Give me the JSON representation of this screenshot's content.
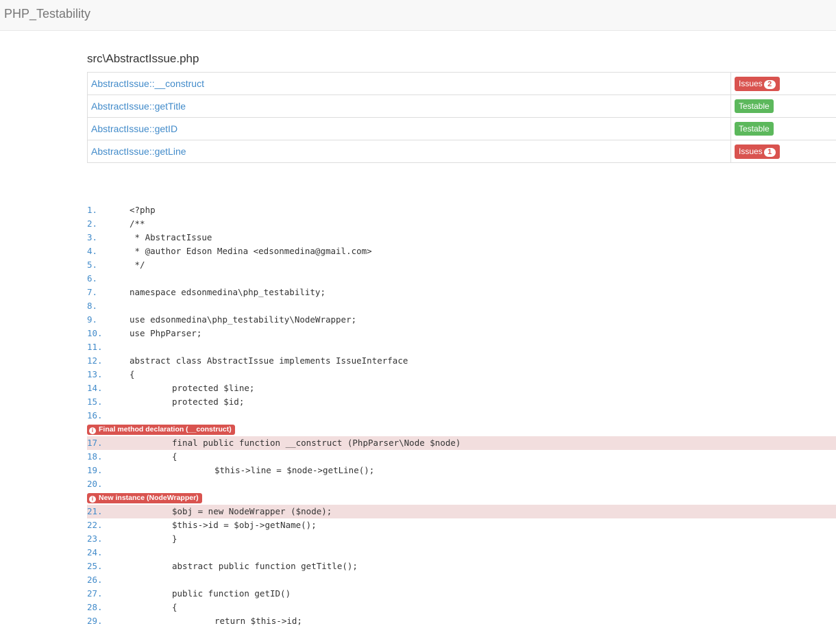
{
  "app": {
    "brand": "PHP_Testability"
  },
  "file": {
    "path": "src\\AbstractIssue.php"
  },
  "methods": [
    {
      "name": "AbstractIssue::__construct",
      "status": "Issues",
      "count": "2",
      "kind": "danger"
    },
    {
      "name": "AbstractIssue::getTitle",
      "status": "Testable",
      "count": null,
      "kind": "success"
    },
    {
      "name": "AbstractIssue::getID",
      "status": "Testable",
      "count": null,
      "kind": "success"
    },
    {
      "name": "AbstractIssue::getLine",
      "status": "Issues",
      "count": "1",
      "kind": "danger"
    }
  ],
  "code": {
    "lines": [
      {
        "num": "1.",
        "indent": 0,
        "text": "<?php"
      },
      {
        "num": "2.",
        "indent": 0,
        "text": "/**"
      },
      {
        "num": "3.",
        "indent": 0,
        "text": " * AbstractIssue"
      },
      {
        "num": "4.",
        "indent": 0,
        "text": " * @author Edson Medina <edsonmedina@gmail.com>"
      },
      {
        "num": "5.",
        "indent": 0,
        "text": " */"
      },
      {
        "num": "6.",
        "indent": 0,
        "text": ""
      },
      {
        "num": "7.",
        "indent": 0,
        "text": "namespace edsonmedina\\php_testability;"
      },
      {
        "num": "8.",
        "indent": 0,
        "text": ""
      },
      {
        "num": "9.",
        "indent": 0,
        "text": "use edsonmedina\\php_testability\\NodeWrapper;"
      },
      {
        "num": "10.",
        "indent": 0,
        "text": "use PhpParser;"
      },
      {
        "num": "11.",
        "indent": 0,
        "text": ""
      },
      {
        "num": "12.",
        "indent": 0,
        "text": "abstract class AbstractIssue implements IssueInterface"
      },
      {
        "num": "13.",
        "indent": 0,
        "text": "{"
      },
      {
        "num": "14.",
        "indent": 1,
        "text": "protected $line;"
      },
      {
        "num": "15.",
        "indent": 1,
        "text": "protected $id;"
      },
      {
        "num": "16.",
        "indent": 0,
        "text": ""
      },
      {
        "num": "17.",
        "indent": 1,
        "text": "final public function __construct (PhpParser\\Node $node)",
        "issue": "Final method declaration (__construct)"
      },
      {
        "num": "18.",
        "indent": 1,
        "text": "{"
      },
      {
        "num": "19.",
        "indent": 2,
        "text": "$this->line = $node->getLine();"
      },
      {
        "num": "20.",
        "indent": 0,
        "text": ""
      },
      {
        "num": "21.",
        "indent": 1,
        "text": "$obj = new NodeWrapper ($node);",
        "issue": "New instance (NodeWrapper)"
      },
      {
        "num": "22.",
        "indent": 1,
        "text": "$this->id = $obj->getName();"
      },
      {
        "num": "23.",
        "indent": 1,
        "text": "}"
      },
      {
        "num": "24.",
        "indent": 0,
        "text": ""
      },
      {
        "num": "25.",
        "indent": 1,
        "text": "abstract public function getTitle();"
      },
      {
        "num": "26.",
        "indent": 0,
        "text": ""
      },
      {
        "num": "27.",
        "indent": 1,
        "text": "public function getID()"
      },
      {
        "num": "28.",
        "indent": 1,
        "text": "{"
      },
      {
        "num": "29.",
        "indent": 2,
        "text": "return $this->id;"
      }
    ]
  },
  "icons": {
    "issue_icon": "info-circle-icon"
  },
  "colors": {
    "link": "#428bca",
    "danger": "#d9534f",
    "success": "#5cb85c",
    "issue_row": "#f2dede"
  }
}
